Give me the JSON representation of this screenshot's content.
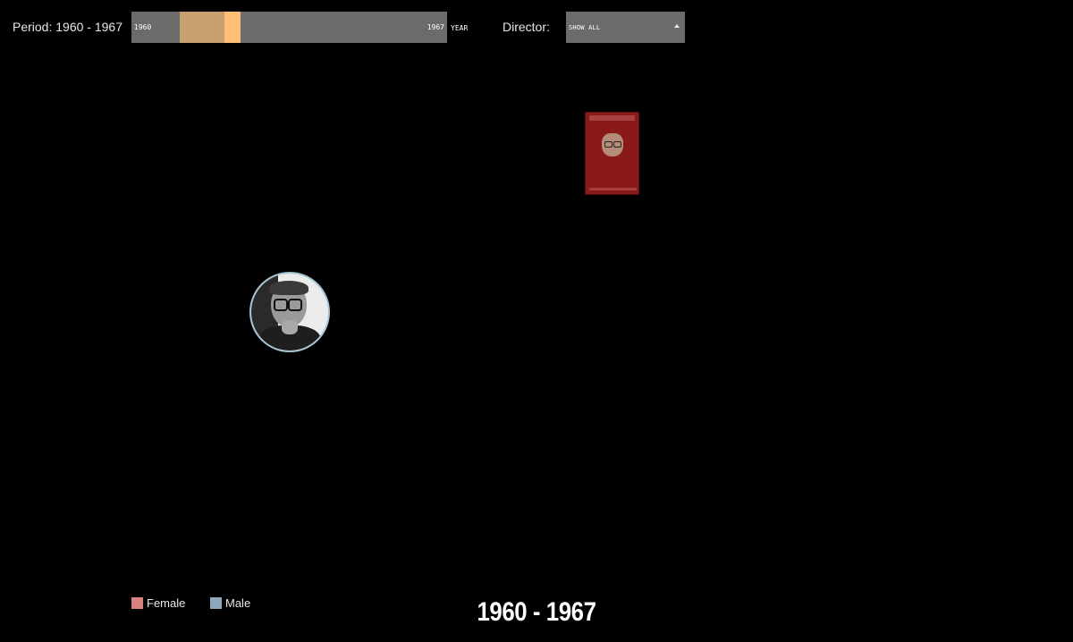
{
  "controls": {
    "period_label": "Period: 1960 - 1967",
    "timeline": {
      "start_label": "1960",
      "end_label": "1967",
      "unit_label": "YEAR",
      "range_color": "#c8a070",
      "handle_color": "#ffbe73"
    },
    "director_label": "Director:",
    "director_select_value": "SHOW ALL"
  },
  "visualization": {
    "director_bubble": {
      "icon": "director-portrait"
    },
    "poster": {
      "icon": "movie-poster"
    }
  },
  "legend": {
    "items": [
      {
        "label": "Female",
        "color": "#d98080"
      },
      {
        "label": "Male",
        "color": "#8ba8bf"
      }
    ]
  },
  "footer": {
    "period_title": "1960 - 1967"
  }
}
